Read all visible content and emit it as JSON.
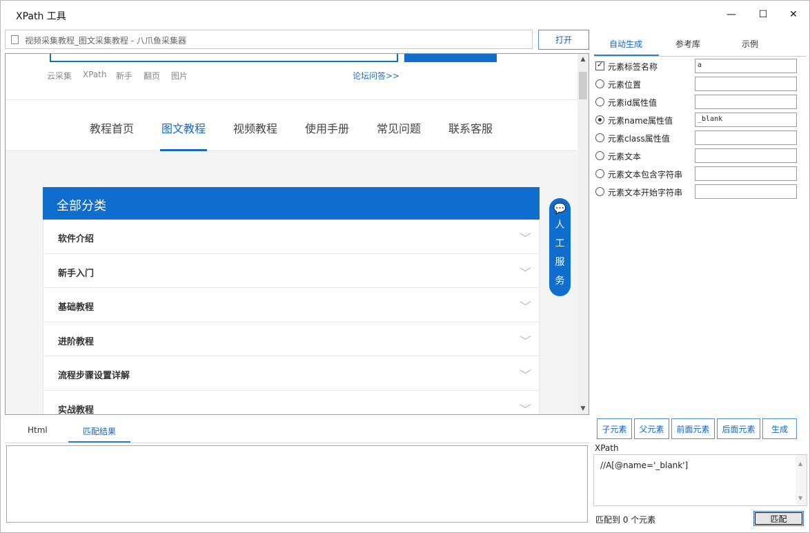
{
  "window": {
    "title": "XPath 工具",
    "min_icon": "—",
    "max_icon": "☐",
    "close_icon": "✕"
  },
  "urlbar": {
    "value": "视频采集教程_图文采集教程 - 八爪鱼采集器",
    "open_label": "打开"
  },
  "web": {
    "quick_links": [
      "云采集",
      "XPath",
      "新手",
      "翻页",
      "图片"
    ],
    "forum_link": "论坛问答>>",
    "nav": [
      "教程首页",
      "图文教程",
      "视频教程",
      "使用手册",
      "常见问题",
      "联系客服"
    ],
    "category_title": "全部分类",
    "categories": [
      "软件介绍",
      "新手入门",
      "基础教程",
      "进阶教程",
      "流程步骤设置详解",
      "实战教程"
    ],
    "service_chars": [
      "人",
      "工",
      "服",
      "务"
    ],
    "chat_icon": "💬",
    "chevron": "⌵"
  },
  "bottom_tabs": [
    "Html",
    "匹配结果"
  ],
  "right": {
    "tabs": [
      "自动生成",
      "参考库",
      "示例"
    ],
    "options": [
      {
        "label": "元素标签名称",
        "value": "a"
      },
      {
        "label": "元素位置",
        "value": ""
      },
      {
        "label": "元素id属性值",
        "value": ""
      },
      {
        "label": "元素name属性值",
        "value": "_blank"
      },
      {
        "label": "元素class属性值",
        "value": ""
      },
      {
        "label": "元素文本",
        "value": ""
      },
      {
        "label": "元素文本包含字符串",
        "value": ""
      },
      {
        "label": "元素文本开始字符串",
        "value": ""
      }
    ],
    "buttons": [
      "子元素",
      "父元素",
      "前面元素",
      "后面元素",
      "生成"
    ],
    "xpath_label": "XPath",
    "xpath_value": "//A[@name='_blank']",
    "match_count": "匹配到 0 个元素",
    "match_label": "匹配"
  }
}
